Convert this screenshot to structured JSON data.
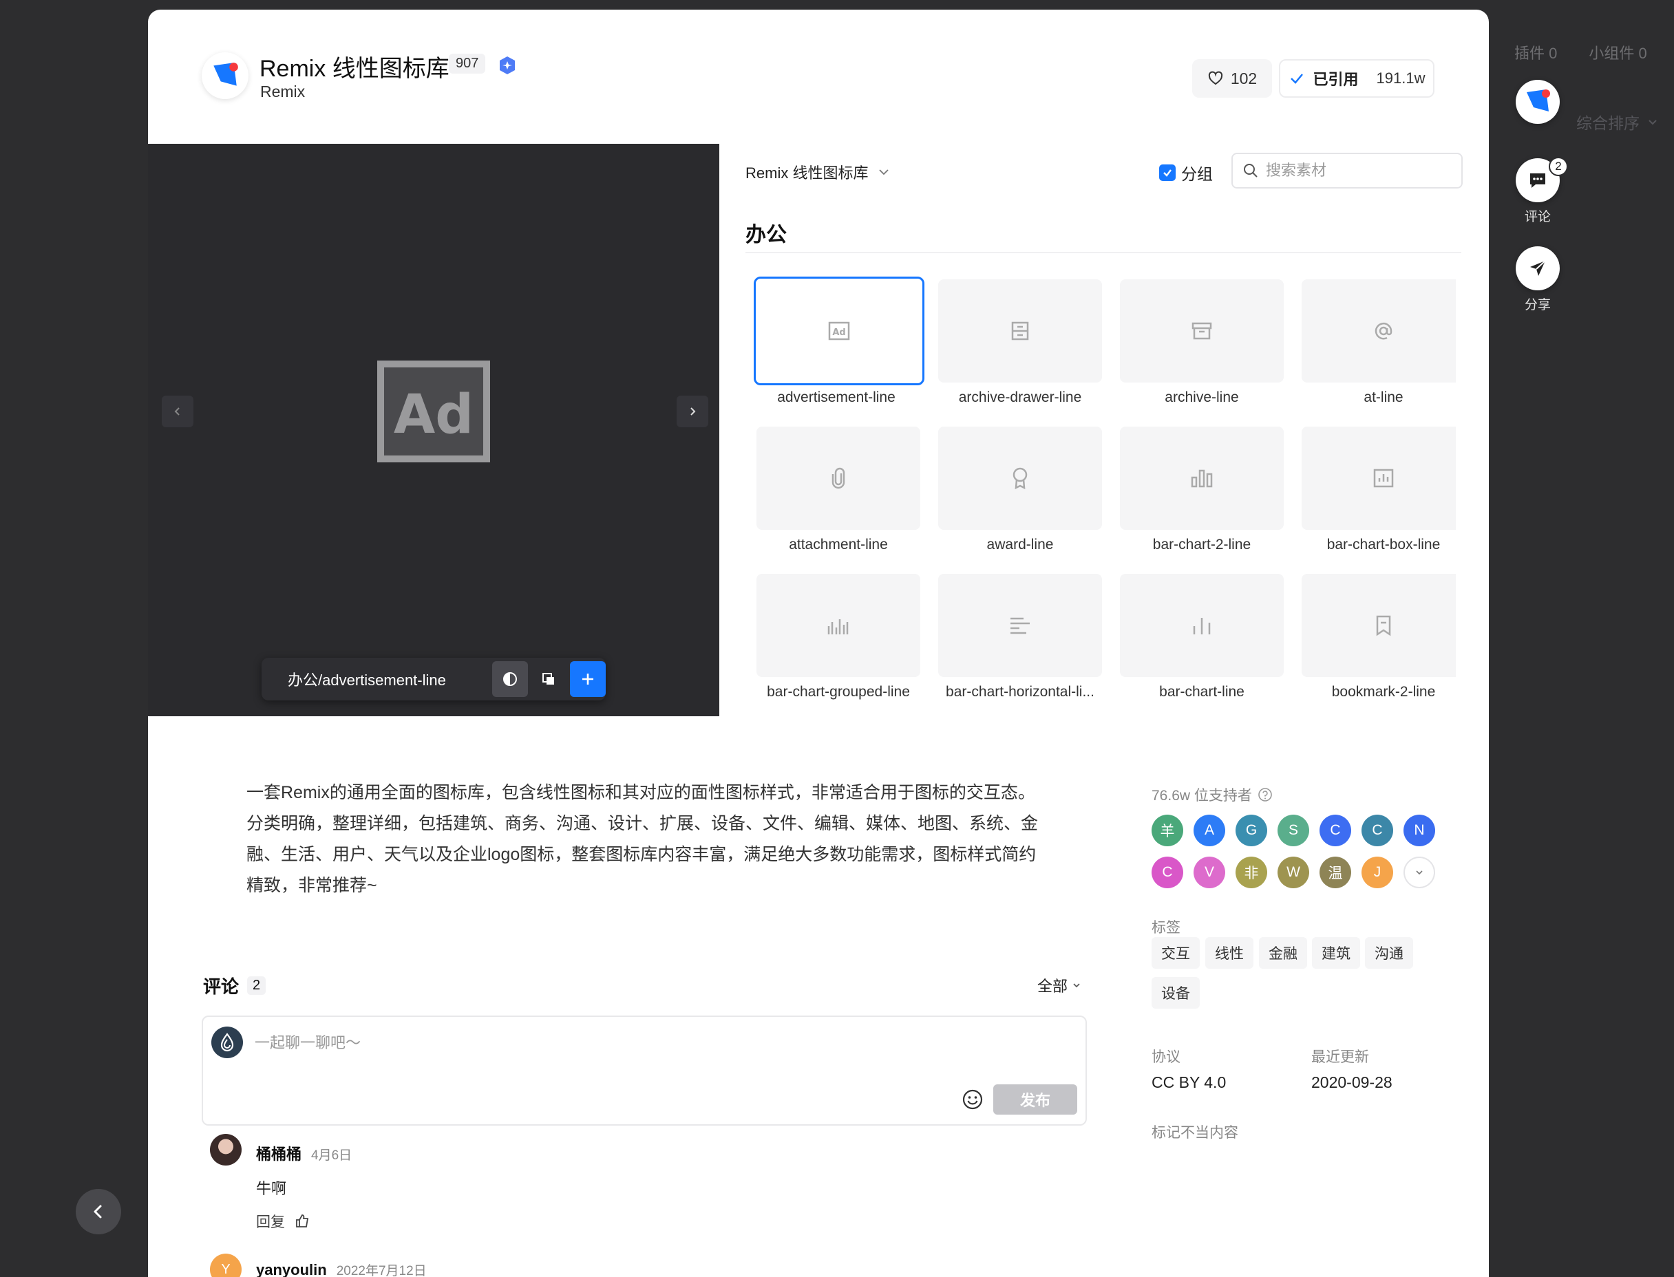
{
  "background": {
    "tabs": [
      {
        "label": "插件",
        "count": "0"
      },
      {
        "label": "小组件",
        "count": "0"
      }
    ],
    "sort_label": "综合排序"
  },
  "header": {
    "title": "Remix 线性图标库",
    "count": "907",
    "author": "Remix",
    "likes": "102",
    "used_label": "已引用",
    "used_count": "191.1w"
  },
  "preview": {
    "icon_text": "Ad",
    "path": "办公/advertisement-line"
  },
  "panel": {
    "library": "Remix 线性图标库",
    "group_label": "分组",
    "search_placeholder": "搜索素材",
    "section": "办公",
    "icons": [
      {
        "label": "advertisement-line",
        "icon": "advertisement-icon"
      },
      {
        "label": "archive-drawer-line",
        "icon": "archive-drawer-icon"
      },
      {
        "label": "archive-line",
        "icon": "archive-icon"
      },
      {
        "label": "at-line",
        "icon": "at-icon"
      },
      {
        "label": "attachment-line",
        "icon": "attachment-icon"
      },
      {
        "label": "award-line",
        "icon": "award-icon"
      },
      {
        "label": "bar-chart-2-line",
        "icon": "bar-chart-2-icon"
      },
      {
        "label": "bar-chart-box-line",
        "icon": "bar-chart-box-icon"
      },
      {
        "label": "bar-chart-grouped-line",
        "icon": "bar-chart-grouped-icon"
      },
      {
        "label": "bar-chart-horizontal-li...",
        "icon": "bar-chart-horizontal-icon"
      },
      {
        "label": "bar-chart-line",
        "icon": "bar-chart-icon"
      },
      {
        "label": "bookmark-2-line",
        "icon": "bookmark-2-icon"
      }
    ]
  },
  "description": "一套Remix的通用全面的图标库，包含线性图标和其对应的面性图标样式，非常适合用于图标的交互态。分类明确，整理详细，包括建筑、商务、沟通、设计、扩展、设备、文件、编辑、媒体、地图、系统、金融、生活、用户、天气以及企业logo图标，整套图标库内容丰富，满足绝大多数功能需求，图标样式简约精致，非常推荐~",
  "comments": {
    "title": "评论",
    "count": "2",
    "filter": "全部",
    "placeholder": "一起聊一聊吧～",
    "publish": "发布",
    "items": [
      {
        "name": "桶桶桶",
        "date": "4月6日",
        "body": "牛啊",
        "reply": "回复"
      },
      {
        "name": "yanyoulin",
        "date": "2022年7月12日",
        "initial": "Y"
      }
    ]
  },
  "info": {
    "supporters_label": "76.6w 位支持者",
    "supporters": [
      {
        "initial": "羊",
        "color": "#4aa87a"
      },
      {
        "initial": "A",
        "color": "#2d7cf6"
      },
      {
        "initial": "G",
        "color": "#3a8fb0"
      },
      {
        "initial": "S",
        "color": "#5aae8c"
      },
      {
        "initial": "C",
        "color": "#3d6df2"
      },
      {
        "initial": "C",
        "color": "#3c87a8"
      },
      {
        "initial": "N",
        "color": "#3a6cf0"
      },
      {
        "initial": "C",
        "color": "#d957c8"
      },
      {
        "initial": "V",
        "color": "#dd6bcc"
      },
      {
        "initial": "非",
        "color": "#a9a24f"
      },
      {
        "initial": "W",
        "color": "#9e9450"
      },
      {
        "initial": "温",
        "color": "#8e8456"
      },
      {
        "initial": "J",
        "color": "#f5a44a"
      }
    ],
    "tags_label": "标签",
    "tags": [
      "交互",
      "线性",
      "金融",
      "建筑",
      "沟通",
      "设备"
    ],
    "license_label": "协议",
    "license": "CC BY 4.0",
    "updated_label": "最近更新",
    "updated": "2020-09-28",
    "report": "标记不当内容"
  },
  "actions": {
    "comment_label": "评论",
    "comment_badge": "2",
    "share_label": "分享"
  },
  "colors": {
    "accent": "#1677ff",
    "backdrop": "#2d2d2f"
  }
}
